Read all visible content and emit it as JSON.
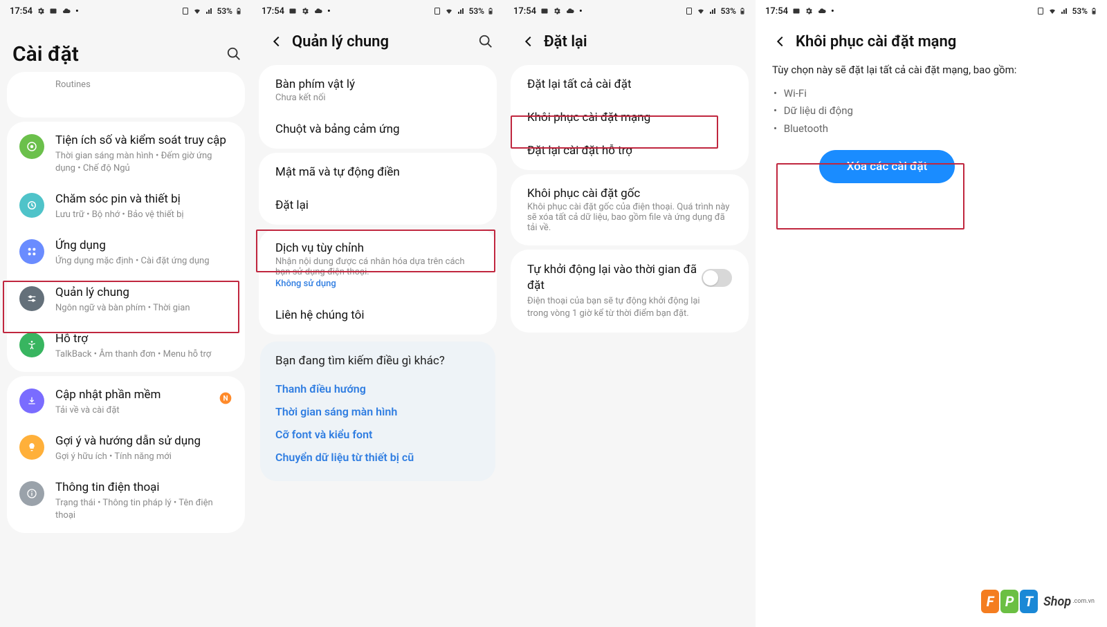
{
  "statusbar": {
    "time": "17:54",
    "battery_text": "53%"
  },
  "p1": {
    "title": "Cài đặt",
    "items_partial_top": "Routines",
    "digital": {
      "title": "Tiện ích số và kiểm soát truy cập",
      "sub": "Thời gian sáng màn hình  •  Đếm giờ ứng dụng  •  Chế độ Ngủ"
    },
    "battery": {
      "title": "Chăm sóc pin và thiết bị",
      "sub": "Lưu trữ  •  Bộ nhớ  •  Bảo vệ thiết bị"
    },
    "apps": {
      "title": "Ứng dụng",
      "sub": "Ứng dụng mặc định  •  Cài đặt ứng dụng"
    },
    "general": {
      "title": "Quản lý chung",
      "sub": "Ngôn ngữ và bàn phím  •  Thời gian"
    },
    "access": {
      "title": "Hỗ trợ",
      "sub": "TalkBack  •  Âm thanh đơn  •  Menu hỗ trợ"
    },
    "update": {
      "title": "Cập nhật phần mềm",
      "sub": "Tải về và cài đặt"
    },
    "tips": {
      "title": "Gợi ý và hướng dẫn sử dụng",
      "sub": "Gợi ý hữu ích  •  Tính năng mới"
    },
    "about": {
      "title": "Thông tin điện thoại",
      "sub": "Trạng thái  •  Thông tin pháp lý  •  Tên điện thoại"
    }
  },
  "p2": {
    "title": "Quản lý chung",
    "keyboard": {
      "title": "Bàn phím vật lý",
      "sub": "Chưa kết nối"
    },
    "mouse": "Chuột và bảng cảm ứng",
    "password": "Mật mã và tự động điền",
    "reset": "Đặt lại",
    "custom": {
      "title": "Dịch vụ tùy chỉnh",
      "sub": "Nhận nội dung được cá nhân hóa dựa trên cách bạn sử dụng điện thoại.",
      "status": "Không sử dụng"
    },
    "contact": "Liên hệ chúng tôi",
    "suggest": {
      "q": "Bạn đang tìm kiếm điều gì khác?",
      "a": "Thanh điều hướng",
      "b": "Thời gian sáng màn hình",
      "c": "Cỡ font và kiểu font",
      "d": "Chuyển dữ liệu từ thiết bị cũ"
    }
  },
  "p3": {
    "title": "Đặt lại",
    "all": "Đặt lại tất cả cài đặt",
    "network": "Khôi phục cài đặt mạng",
    "a11y": "Đặt lại cài đặt hỗ trợ",
    "factory": {
      "title": "Khôi phục cài đặt gốc",
      "sub": "Khôi phục cài đặt gốc của điện thoại. Quá trình này sẽ xóa tất cả dữ liệu, bao gồm file và ứng dụng đã tải về."
    },
    "auto": {
      "title": "Tự khởi động lại vào thời gian đã đặt",
      "sub": "Điện thoại của bạn sẽ tự động khởi động lại trong vòng 1 giờ kể từ thời điểm bạn đặt."
    }
  },
  "p4": {
    "title": "Khôi phục cài đặt mạng",
    "desc": "Tùy chọn này sẽ đặt lại tất cả cài đặt mạng, bao gồm:",
    "b1": "Wi-Fi",
    "b2": "Dữ liệu di động",
    "b3": "Bluetooth",
    "button": "Xóa các cài đặt"
  },
  "watermark": {
    "brand": "Shop",
    "domain": ".com.vn"
  }
}
